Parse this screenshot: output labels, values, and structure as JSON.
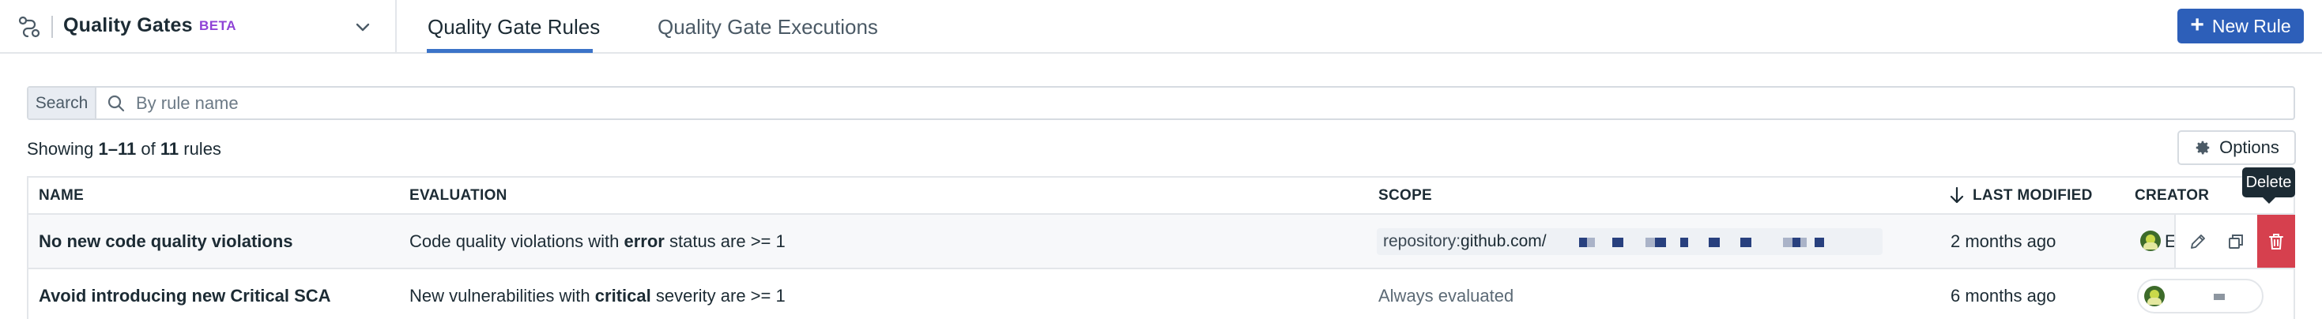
{
  "header": {
    "product_title": "Quality Gates",
    "badge": "BETA",
    "tabs": [
      {
        "label": "Quality Gate Rules",
        "active": true
      },
      {
        "label": "Quality Gate Executions",
        "active": false
      }
    ],
    "new_rule_label": "New Rule"
  },
  "search": {
    "label": "Search",
    "placeholder": "By rule name",
    "value": ""
  },
  "summary": {
    "prefix": "Showing",
    "range": "1–11",
    "of": "of",
    "total": "11",
    "suffix": "rules",
    "options_label": "Options"
  },
  "table": {
    "columns": {
      "name": "NAME",
      "evaluation": "EVALUATION",
      "scope": "SCOPE",
      "last_modified": "LAST MODIFIED",
      "creator": "CREATOR"
    },
    "sort_column": "last_modified",
    "sort_direction": "descending",
    "rows": [
      {
        "name": "No new code quality violations",
        "evaluation_pre": "Code quality violations with",
        "evaluation_keyword": "error",
        "evaluation_post": "status are >= 1",
        "scope_key": "repository:",
        "scope_value": "github.com/",
        "last_modified": "2 months ago",
        "creator_initial": "E"
      },
      {
        "name": "Avoid introducing new Critical SCA",
        "evaluation_pre": "New vulnerabilities with",
        "evaluation_keyword": "critical",
        "evaluation_post": "severity are >= 1",
        "scope_text": "Always evaluated",
        "last_modified": "6 months ago"
      }
    ]
  },
  "tooltip": {
    "text": "Delete"
  },
  "colors": {
    "primary": "#2d5fb9",
    "beta": "#8f43d6",
    "tab_active_underline": "#3b73c8",
    "delete": "#d6404e"
  },
  "icons": [
    "flow-icon",
    "chevron-down-icon",
    "plus-icon",
    "search-icon",
    "gear-icon",
    "sort-down-arrow-icon",
    "edit-icon",
    "clone-icon",
    "trash-icon",
    "avatar"
  ]
}
